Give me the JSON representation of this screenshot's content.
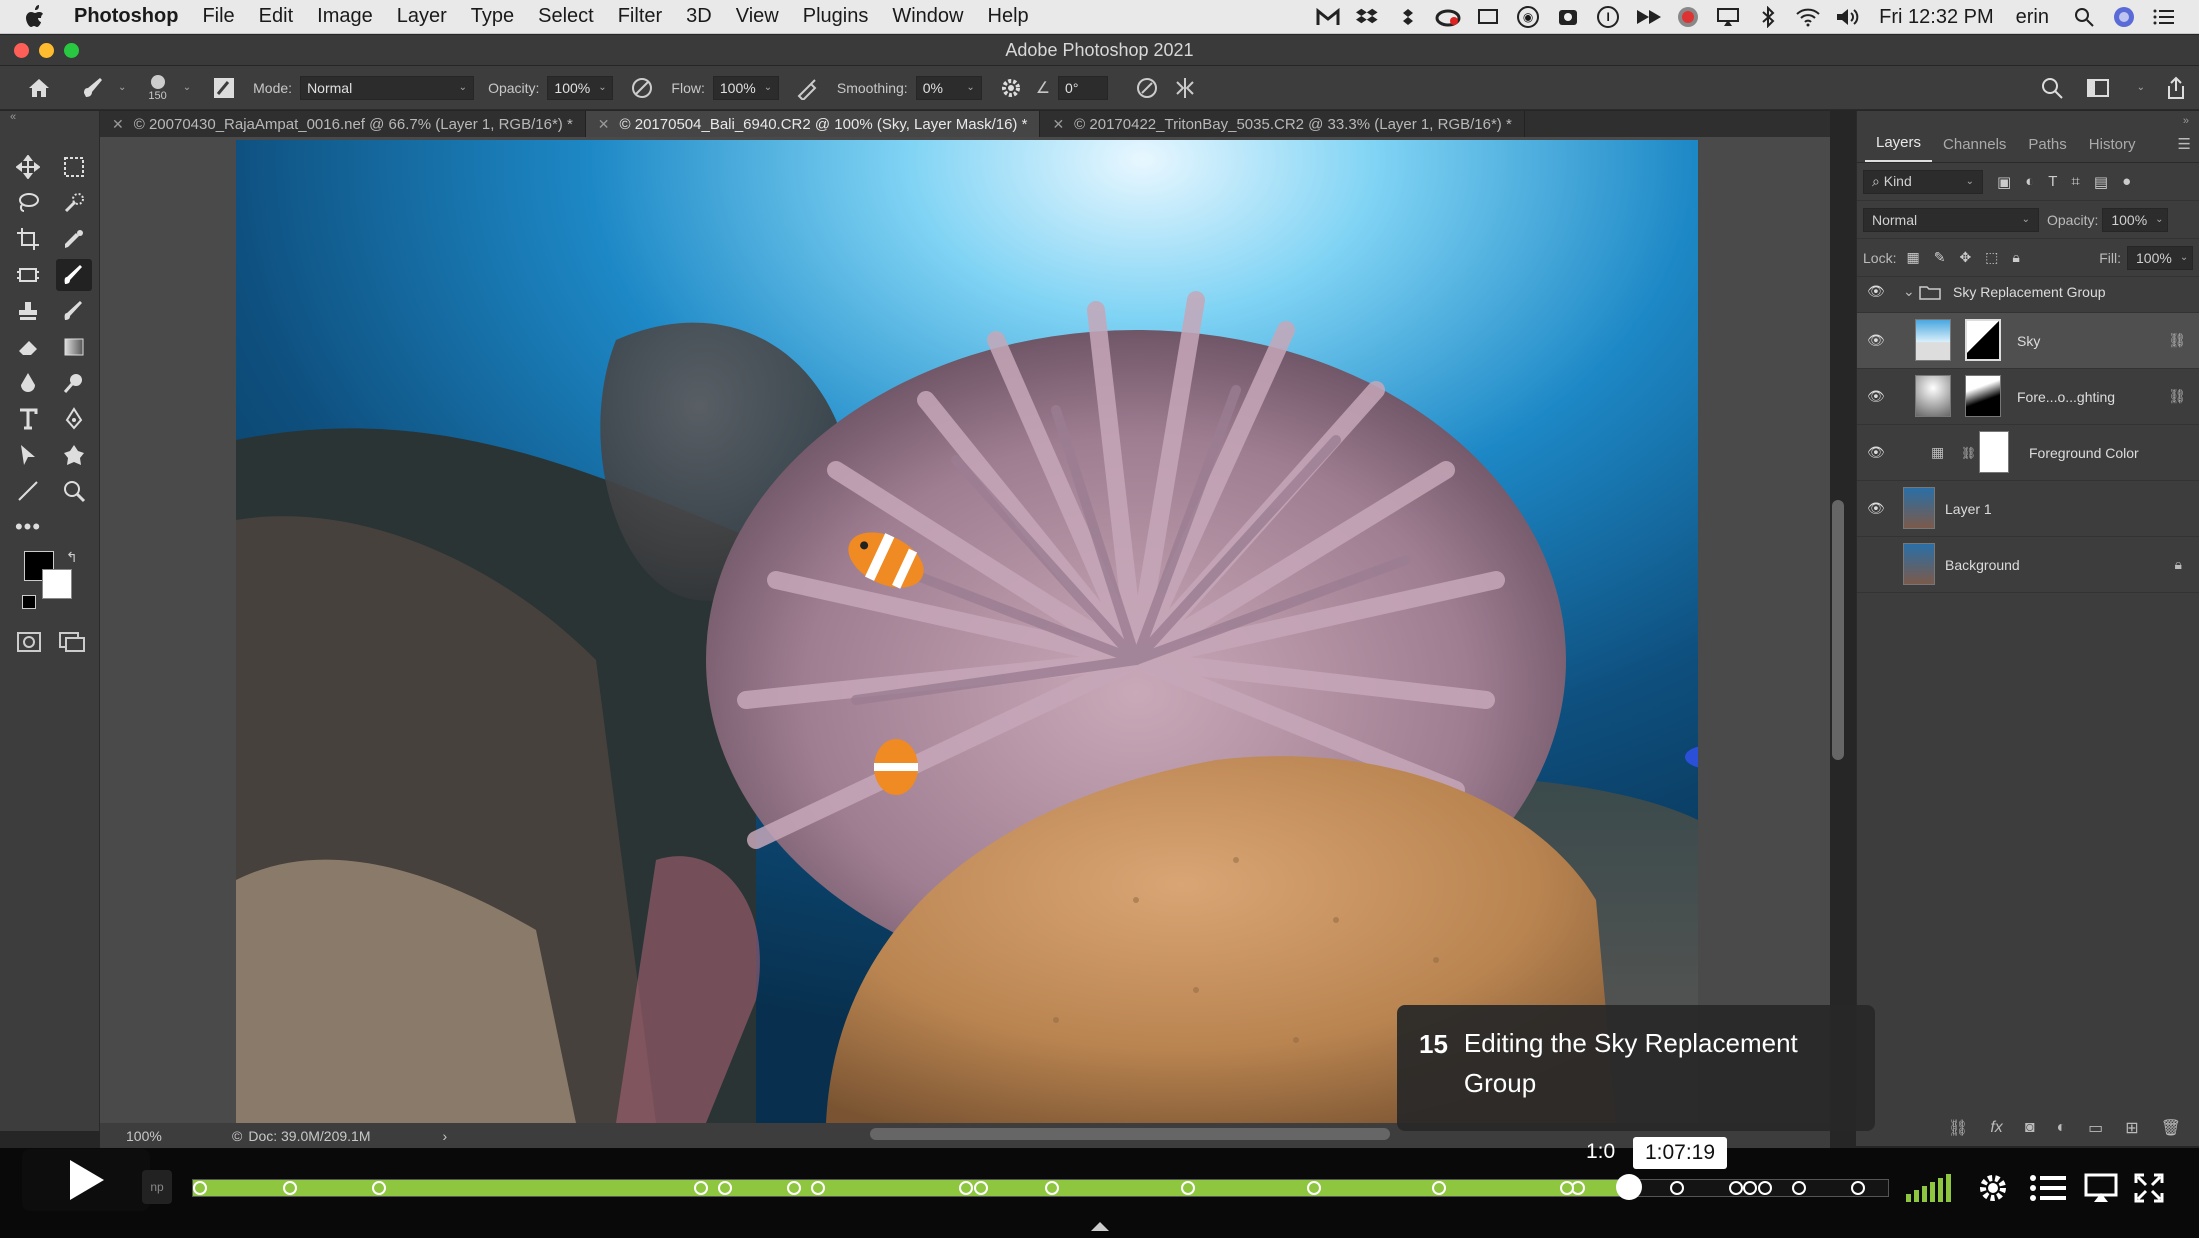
{
  "menubar": {
    "app_name": "Photoshop",
    "items": [
      "File",
      "Edit",
      "Image",
      "Layer",
      "Type",
      "Select",
      "Filter",
      "3D",
      "View",
      "Plugins",
      "Window",
      "Help"
    ],
    "clock": "Fri 12:32 PM",
    "user": "erin"
  },
  "window": {
    "title": "Adobe Photoshop 2021"
  },
  "options": {
    "brush_size": "150",
    "mode_label": "Mode:",
    "mode_value": "Normal",
    "opacity_label": "Opacity:",
    "opacity_value": "100%",
    "flow_label": "Flow:",
    "flow_value": "100%",
    "smoothing_label": "Smoothing:",
    "smoothing_value": "0%",
    "angle_value": "0°"
  },
  "tabs": [
    {
      "label": "© 20070430_RajaAmpat_0016.nef @ 66.7% (Layer 1, RGB/16*) *"
    },
    {
      "label": "© 20170504_Bali_6940.CR2 @ 100% (Sky, Layer Mask/16) *"
    },
    {
      "label": "© 20170422_TritonBay_5035.CR2 @ 33.3% (Layer 1, RGB/16*) *"
    }
  ],
  "status": {
    "zoom": "100%",
    "doc": "Doc: 39.0M/209.1M"
  },
  "panel": {
    "tabs": [
      "Layers",
      "Channels",
      "Paths",
      "History"
    ],
    "filter_kind": "Kind",
    "blend_mode": "Normal",
    "opacity_label": "Opacity:",
    "opacity_value": "100%",
    "lock_label": "Lock:",
    "fill_label": "Fill:",
    "fill_value": "100%",
    "layers": {
      "group": "Sky Replacement Group",
      "sky": "Sky",
      "foreground_lighting": "Fore...o...ghting",
      "foreground_color": "Foreground Color",
      "layer1": "Layer 1",
      "background": "Background"
    }
  },
  "chapter": {
    "number": "15",
    "title": "Editing the Sky Replacement Group"
  },
  "player": {
    "tooltip_time": "1:07:19",
    "behind_time": "1:0",
    "preview_label": "np",
    "progress": 0.847,
    "chapter_markers": [
      0.005,
      0.058,
      0.11,
      0.3,
      0.314,
      0.355,
      0.369,
      0.456,
      0.465,
      0.507,
      0.587,
      0.661,
      0.735,
      0.817,
      0.81,
      0.875,
      0.91,
      0.918,
      0.927,
      0.947,
      0.982
    ],
    "accent": "#8ec63f"
  }
}
